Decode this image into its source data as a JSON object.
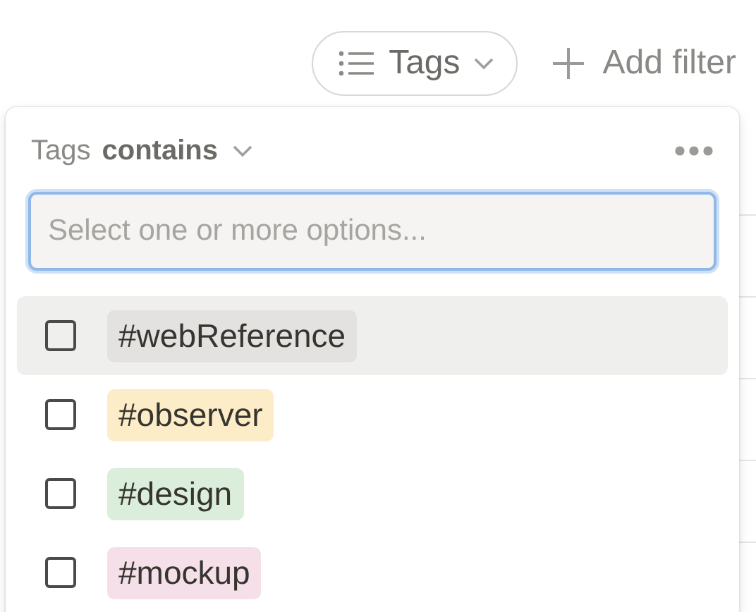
{
  "filter_bar": {
    "tag_filter": {
      "label": "Tags"
    },
    "add_filter": {
      "label": "Add filter"
    }
  },
  "popup": {
    "property": "Tags",
    "operator": "contains",
    "search": {
      "placeholder": "Select one or more options..."
    },
    "options": [
      {
        "label": "#webReference",
        "color": "#e3e2e0",
        "checked": false,
        "highlighted": true
      },
      {
        "label": "#observer",
        "color": "#fdecc8",
        "checked": false,
        "highlighted": false
      },
      {
        "label": "#design",
        "color": "#dbeddb",
        "checked": false,
        "highlighted": false
      },
      {
        "label": "#mockup",
        "color": "#f5e0e9",
        "checked": false,
        "highlighted": false
      }
    ]
  }
}
